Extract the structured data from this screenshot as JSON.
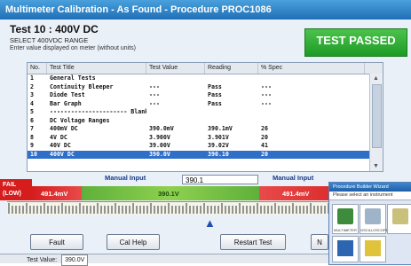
{
  "window": {
    "title": "Multimeter Calibration - As Found - Procedure PROC1086"
  },
  "header": {
    "test_name": "Test 10 : 400V DC",
    "range": "SELECT 400VDC RANGE",
    "instruction": "Enter value displayed on meter (without units)"
  },
  "status_banner": "TEST PASSED",
  "table": {
    "columns": [
      "No.",
      "Test Title",
      "Test Value",
      "Reading",
      "% Spec"
    ],
    "rows": [
      {
        "no": "1",
        "title": "General Tests",
        "value": "",
        "reading": "",
        "spec": ""
      },
      {
        "no": "2",
        "title": "Continuity Bleeper",
        "value": "---",
        "reading": "Pass",
        "spec": "---"
      },
      {
        "no": "3",
        "title": "Diode Test",
        "value": "---",
        "reading": "Pass",
        "spec": "---"
      },
      {
        "no": "4",
        "title": "Bar Graph",
        "value": "---",
        "reading": "Pass",
        "spec": "---"
      },
      {
        "no": "5",
        "title": "---------------------- Blank Line ----------------------",
        "value": "",
        "reading": "",
        "spec": ""
      },
      {
        "no": "6",
        "title": "DC Voltage Ranges",
        "value": "",
        "reading": "",
        "spec": ""
      },
      {
        "no": "7",
        "title": "400mV DC",
        "value": "390.0mV",
        "reading": "390.1mV",
        "spec": "26"
      },
      {
        "no": "8",
        "title": "4V DC",
        "value": "3.900V",
        "reading": "3.901V",
        "spec": "20"
      },
      {
        "no": "9",
        "title": "40V DC",
        "value": "39.00V",
        "reading": "39.02V",
        "spec": "41"
      },
      {
        "no": "10",
        "title": "400V DC",
        "value": "390.0V",
        "reading": "390.10",
        "spec": "20"
      }
    ]
  },
  "meter": {
    "fail_label": "FAIL",
    "low_label": "(LOW)",
    "left_limit": "491.4mV",
    "center_value": "390.1V",
    "right_limit": "491.4mV",
    "manual_input_label": "Manual Input",
    "manual_input_label_right": "Manual Input",
    "manual_input_value": "390.1"
  },
  "buttons": {
    "fault": "Fault",
    "cal_help": "Cal Help",
    "restart": "Restart Test",
    "next": "N"
  },
  "status_bar": {
    "label": "Test Value:",
    "value": "390.0V"
  },
  "wizard": {
    "title": "Procedure Builder Wizard",
    "prompt": "Please select an instrument",
    "items": [
      "MULTIMETER",
      "OSCILLOSCOPE",
      ""
    ]
  },
  "colors": {
    "pass_green": "#1e9b25",
    "fail_red": "#d61d1d",
    "title_blue": "#1f6fb6",
    "selected_row": "#2f6fc8"
  }
}
